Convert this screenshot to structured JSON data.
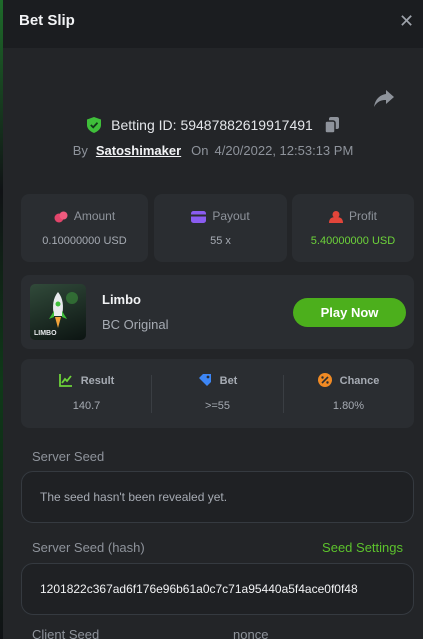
{
  "header": {
    "title": "Bet Slip",
    "close_icon": "close-icon"
  },
  "bet": {
    "betting_id_label": "Betting ID:",
    "betting_id": "59487882619917491",
    "by_label": "By",
    "user": "Satoshimaker",
    "on_label": "On",
    "date": "4/20/2022, 12:53:13 PM"
  },
  "stats": {
    "amount": {
      "label": "Amount",
      "value": "0.10000000 USD",
      "icon": "coins-icon"
    },
    "payout": {
      "label": "Payout",
      "value": "55 x",
      "icon": "wallet-icon"
    },
    "profit": {
      "label": "Profit",
      "value": "5.40000000 USD",
      "icon": "profit-icon"
    }
  },
  "game": {
    "name": "Limbo",
    "provider": "BC Original",
    "thumb_text": "LIMBO",
    "play_label": "Play Now"
  },
  "results": {
    "result": {
      "label": "Result",
      "value": "140.7",
      "icon": "chart-icon"
    },
    "bet": {
      "label": "Bet",
      "value": ">=55",
      "icon": "tag-icon"
    },
    "chance": {
      "label": "Chance",
      "value": "1.80%",
      "icon": "percent-icon"
    }
  },
  "seeds": {
    "server_seed_label": "Server Seed",
    "server_seed_value": "The seed hasn't been revealed yet.",
    "server_hash_label": "Server Seed (hash)",
    "seed_settings_label": "Seed Settings",
    "server_hash_value": "1201822c367ad6f176e96b61a0c7c71a95440a5f4ace0f0f48",
    "client_seed_label": "Client Seed",
    "nonce_label": "nonce"
  },
  "colors": {
    "accent_green": "#4caf1c",
    "profit_green": "#6dd33a",
    "panel_bg": "#232528",
    "card_bg": "#2a2d31"
  }
}
